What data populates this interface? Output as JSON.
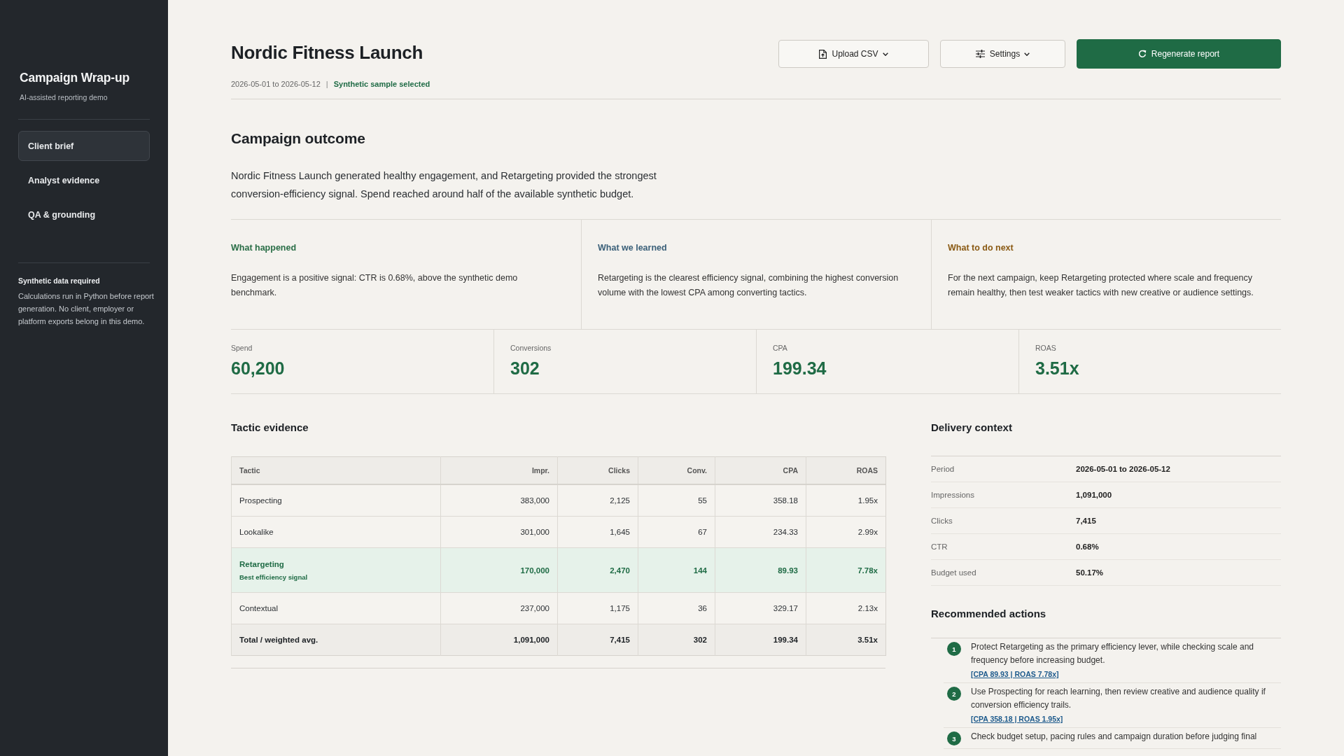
{
  "sidebar": {
    "title": "Campaign Wrap-up",
    "subtitle": "AI-assisted reporting demo",
    "items": [
      {
        "label": "Client brief",
        "selected": true
      },
      {
        "label": "Analyst evidence",
        "selected": false
      },
      {
        "label": "QA & grounding",
        "selected": false
      }
    ],
    "notice": {
      "title": "Synthetic data required",
      "text": "Calculations run in Python before report generation. No client, employer or platform exports belong in this demo."
    }
  },
  "header": {
    "title": "Nordic Fitness Launch",
    "period": "2026-05-01 to 2026-05-12",
    "separator": "|",
    "status": "Synthetic sample selected",
    "buttons": [
      {
        "label": "Upload CSV",
        "kind": "menu"
      },
      {
        "label": "Settings",
        "kind": "menu"
      },
      {
        "label": "Regenerate report",
        "kind": "primary"
      }
    ]
  },
  "outcome": {
    "title": "Campaign outcome",
    "summary": "Nordic Fitness Launch generated healthy engagement, and Retargeting provided the strongest conversion-efficiency signal. Spend reached around half of the available synthetic budget.",
    "insights": [
      {
        "title": "What happened",
        "color": "#2a6e47",
        "text": "Engagement is a positive signal: CTR is 0.68%, above the synthetic demo benchmark."
      },
      {
        "title": "What we learned",
        "color": "#3b6079",
        "text": "Retargeting is the clearest efficiency signal, combining the highest conversion volume with the lowest CPA among converting tactics."
      },
      {
        "title": "What to do next",
        "color": "#8a5a14",
        "text": "For the next campaign, keep Retargeting protected where scale and frequency remain healthy, then test weaker tactics with new creative or audience settings."
      }
    ]
  },
  "kpis": [
    {
      "label": "Spend",
      "value": "60,200"
    },
    {
      "label": "Conversions",
      "value": "302"
    },
    {
      "label": "CPA",
      "value": "199.34"
    },
    {
      "label": "ROAS",
      "value": "3.51x"
    }
  ],
  "tactic_evidence": {
    "title": "Tactic evidence",
    "columns": [
      "Tactic",
      "Impr.",
      "Clicks",
      "Conv.",
      "CPA",
      "ROAS"
    ],
    "rows": [
      {
        "kind": "standard",
        "cells": [
          "Prospecting",
          "383,000",
          "2,125",
          "55",
          "358.18",
          "1.95x"
        ]
      },
      {
        "kind": "standard",
        "cells": [
          "Lookalike",
          "301,000",
          "1,645",
          "67",
          "234.33",
          "2.99x"
        ]
      },
      {
        "kind": "best",
        "note": "Best efficiency signal",
        "cells": [
          "Retargeting",
          "170,000",
          "2,470",
          "144",
          "89.93",
          "7.78x"
        ]
      },
      {
        "kind": "standard",
        "cells": [
          "Contextual",
          "237,000",
          "1,175",
          "36",
          "329.17",
          "2.13x"
        ]
      },
      {
        "kind": "total",
        "cells": [
          "Total / weighted avg.",
          "1,091,000",
          "7,415",
          "302",
          "199.34",
          "3.51x"
        ]
      }
    ]
  },
  "delivery_context": {
    "title": "Delivery context",
    "rows": [
      {
        "label": "Period",
        "value": "2026-05-01 to 2026-05-12"
      },
      {
        "label": "Impressions",
        "value": "1,091,000"
      },
      {
        "label": "Clicks",
        "value": "7,415"
      },
      {
        "label": "CTR",
        "value": "0.68%"
      },
      {
        "label": "Budget used",
        "value": "50.17%"
      }
    ]
  },
  "recommended_actions": {
    "title": "Recommended actions",
    "items": [
      {
        "number": "1",
        "text": "Protect Retargeting as the primary efficiency lever, while checking scale and frequency before increasing budget.",
        "evidence": "[CPA 89.93 | ROAS 7.78x]"
      },
      {
        "number": "2",
        "text": "Use Prospecting for reach learning, then review creative and audience quality if conversion efficiency trails.",
        "evidence": "[CPA 358.18 | ROAS 1.95x]"
      },
      {
        "number": "3",
        "text": "Check budget setup, pacing rules and campaign duration before judging final"
      }
    ]
  }
}
